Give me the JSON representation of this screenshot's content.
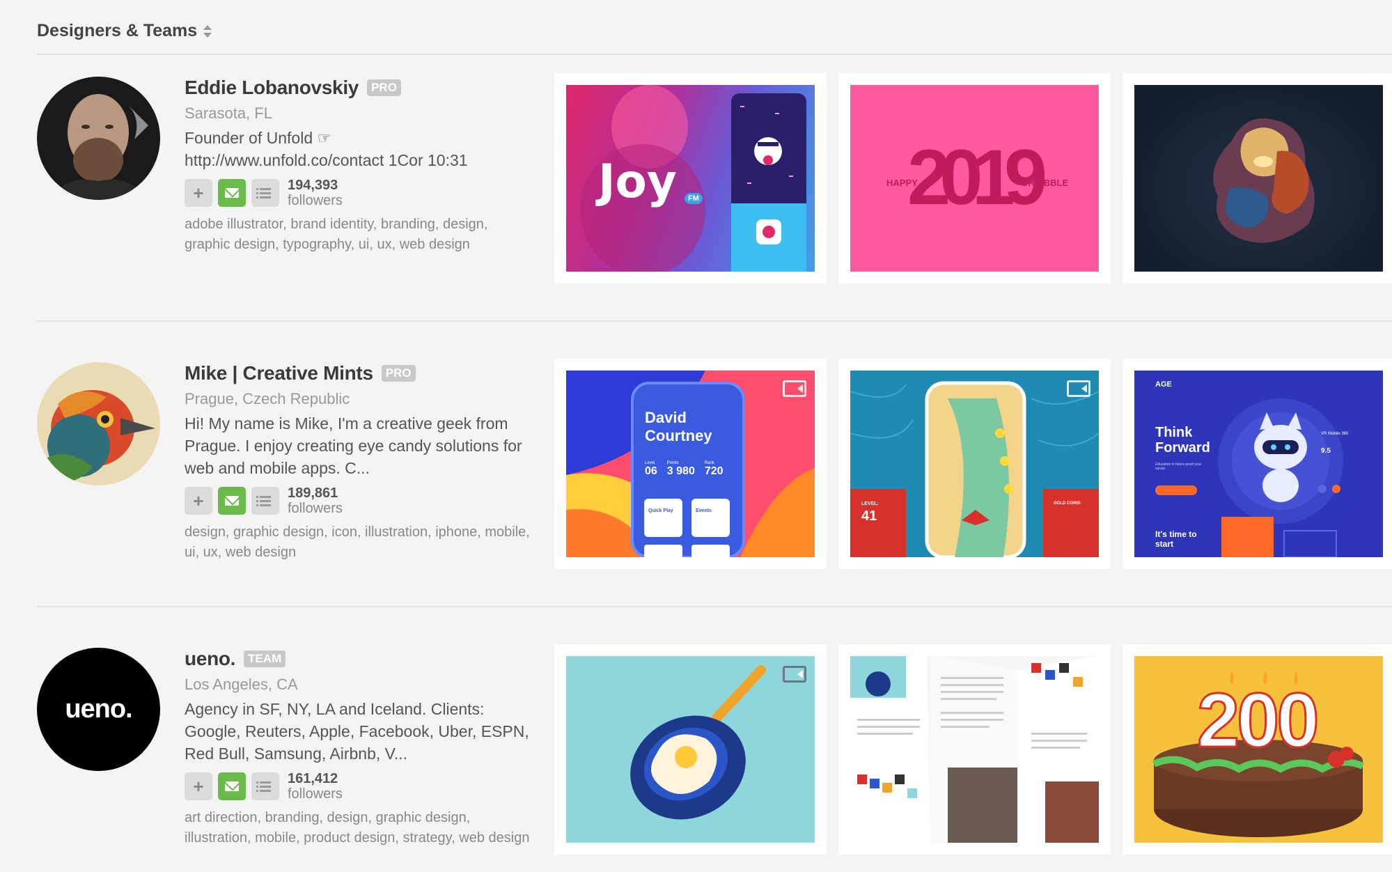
{
  "header": {
    "title": "Designers & Teams"
  },
  "designers": [
    {
      "name": "Eddie Lobanovskiy",
      "badge": "PRO",
      "location": "Sarasota, FL",
      "bio_line1": "Founder of Unfold ☞",
      "bio_line2": "http://www.unfold.co/contact 1Cor 10:31",
      "followers_count": "194,393",
      "followers_label": "followers",
      "tags": "adobe illustrator, brand identity, branding, design, graphic design, typography, ui, ux, web design",
      "shots": [
        {
          "word": "Joy",
          "sub": "FM"
        },
        {
          "left": "HAPPY",
          "mid": "2019",
          "right": "DRIBBBLE"
        },
        {}
      ]
    },
    {
      "name": "Mike | Creative Mints",
      "badge": "PRO",
      "location": "Prague, Czech Republic",
      "bio": "Hi! My name is Mike, I'm a creative geek from Prague. I enjoy creating eye candy solutions for web and mobile apps. C...",
      "followers_count": "189,861",
      "followers_label": "followers",
      "tags": "design, graphic design, icon, illustration, iphone, mobile, ui, ux, web design",
      "shots": [
        {
          "title": "David Courtney",
          "s1l": "Level",
          "s1": "06",
          "s2l": "Points",
          "s2": "3 980",
          "s3l": "Rank",
          "s3": "720",
          "c1": "Quick Play",
          "c2": "Events"
        },
        {
          "level_label": "LEVEL:",
          "level": "41",
          "coins_label": "GOLD COINS:"
        },
        {
          "brand": "AGE",
          "headline": "Think Forward",
          "sub": "Education to future-proof your career.",
          "cta": "It's time to start",
          "side1": "VR Mobile 360",
          "side2": "9.5"
        }
      ]
    },
    {
      "name": "ueno.",
      "badge": "TEAM",
      "location": "Los Angeles, CA",
      "bio": "Agency in SF, NY, LA and Iceland. Clients: Google, Reuters, Apple, Facebook, Uber, ESPN, Red Bull, Samsung, Airbnb, V...",
      "followers_count": "161,412",
      "followers_label": "followers",
      "tags": "art direction, branding, design, graphic design, illustration, mobile, product design, strategy, web design",
      "logo": "ueno.",
      "shots": [
        {},
        {},
        {
          "number": "200"
        }
      ]
    }
  ]
}
